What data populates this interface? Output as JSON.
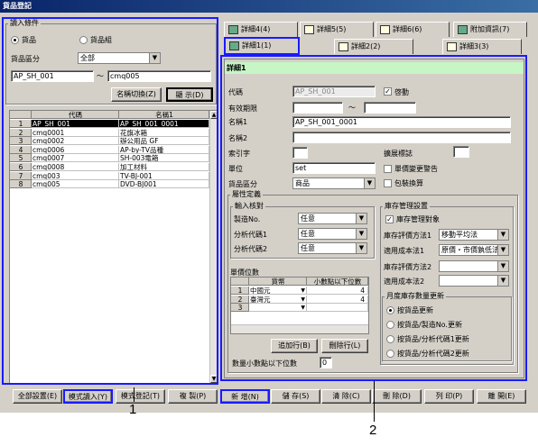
{
  "window": {
    "title": "貨品登記"
  },
  "left": {
    "group_title": "讀入條件",
    "radio_item": "貨品",
    "radio_group": "貨品組",
    "type_label": "貨品區分",
    "type_value": "全部",
    "code_from": "AP_SH_001",
    "range_sep": "～",
    "code_to": "cmq005",
    "rename_button": "名稱切換(Z)",
    "show_button": "顯 示(D)",
    "col_code": "代碼",
    "col_name": "名稱1",
    "rows": [
      {
        "no": "1",
        "code": "AP_SH_001",
        "name": "AP_SH_001_0001"
      },
      {
        "no": "2",
        "code": "cmq0001",
        "name": "花旗冰箱"
      },
      {
        "no": "3",
        "code": "cmq0002",
        "name": "辦公用品 GF"
      },
      {
        "no": "4",
        "code": "cmq0006",
        "name": "AP-by-TV品種"
      },
      {
        "no": "5",
        "code": "cmq0007",
        "name": "SH-003電箱"
      },
      {
        "no": "6",
        "code": "cmq0008",
        "name": "加工材料"
      },
      {
        "no": "7",
        "code": "cmq003",
        "name": "TV-BJ-001"
      },
      {
        "no": "8",
        "code": "cmq005",
        "name": "DVD-BJ001"
      }
    ]
  },
  "tabs": {
    "row1": [
      "詳細4(4)",
      "詳細5(5)",
      "詳細6(6)",
      "附加資訊(7)"
    ],
    "row2": [
      "詳細1(1)",
      "詳細2(2)",
      "詳細3(3)"
    ]
  },
  "detail": {
    "header": "詳細1",
    "code_label": "代碼",
    "code_value": "AP_SH_001",
    "active_label": "啓動",
    "period_label": "有效期限",
    "period_sep": "～",
    "name1_label": "名稱1",
    "name1_value": "AP_SH_001_0001",
    "name2_label": "名稱2",
    "index_label": "索引字",
    "extend_label": "擴展標誌",
    "unit_label": "單位",
    "unit_value": "set",
    "price_change_label": "單價變更警告",
    "type_label": "貨品區分",
    "type_value": "商品",
    "pack_label": "包裝換算",
    "attr_title": "屬性定義",
    "input_check_title": "輸入核對",
    "mfg_label": "製造No.",
    "mfg_value": "任意",
    "ana1_label": "分析代碼1",
    "ana1_value": "任意",
    "ana2_label": "分析代碼2",
    "ana2_value": "任意",
    "price_digits_title": "單價位數",
    "pd_col_currency": "貨幣",
    "pd_col_digits": "小數點以下位數",
    "pd_rows": [
      {
        "no": "1",
        "currency": "中國元",
        "digits": "4"
      },
      {
        "no": "2",
        "currency": "臺灣元",
        "digits": "4"
      },
      {
        "no": "3",
        "currency": "",
        "digits": ""
      }
    ],
    "add_row_button": "追加行(B)",
    "del_row_button": "刪除行(L)",
    "qty_decimal_label": "數量小數點以下位數",
    "qty_decimal_value": "0",
    "stock_title": "庫存管理設置",
    "stock_manage_label": "庫存管理對象",
    "eval1_label": "庫存評價方法1",
    "eval1_value": "移動平均法",
    "cost1_label": "適用成本法1",
    "cost1_value": "原價・市價孰低法",
    "eval2_label": "庫存評價方法2",
    "cost2_label": "適用成本法2",
    "monthly_title": "月度庫存數量更新",
    "monthly_options": [
      "按貨品更新",
      "按貨品/製造No.更新",
      "按貨品/分析代碼1更新",
      "按貨品/分析代碼2更新"
    ]
  },
  "toolbar": [
    "全部設置(E)",
    "模式讀入(Y)",
    "模式登記(T)",
    "複 製(P)",
    "新 增(N)",
    "儲 存(S)",
    "清 除(C)",
    "刪 除(D)",
    "列 印(P)",
    "離 開(E)"
  ],
  "callouts": [
    "1",
    "2"
  ]
}
